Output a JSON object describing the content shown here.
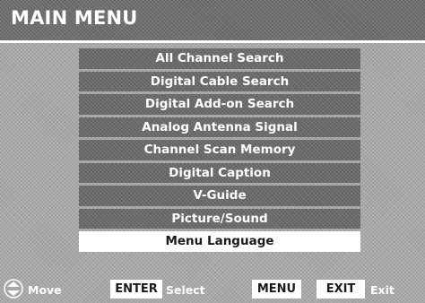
{
  "header": {
    "title": "MAIN MENU"
  },
  "menu": {
    "items": [
      {
        "label": "All Channel Search"
      },
      {
        "label": "Digital Cable Search"
      },
      {
        "label": "Digital Add-on Search"
      },
      {
        "label": "Analog Antenna Signal"
      },
      {
        "label": "Channel Scan Memory"
      },
      {
        "label": "Digital Caption"
      },
      {
        "label": "V-Guide"
      },
      {
        "label": "Picture/Sound"
      },
      {
        "label": "Menu Language"
      }
    ],
    "selected_index": 8
  },
  "footer": {
    "move_icon": "up-down-arrow-icon",
    "move_label": "Move",
    "enter_key": "ENTER",
    "select_label": "Select",
    "menu_key": "MENU",
    "exit_key": "EXIT",
    "exit_label": "Exit"
  },
  "colors": {
    "background": "#a8a8a8",
    "item_bg": "#6a6a6a",
    "selected_bg": "#ffffff",
    "text": "#ffffff"
  }
}
